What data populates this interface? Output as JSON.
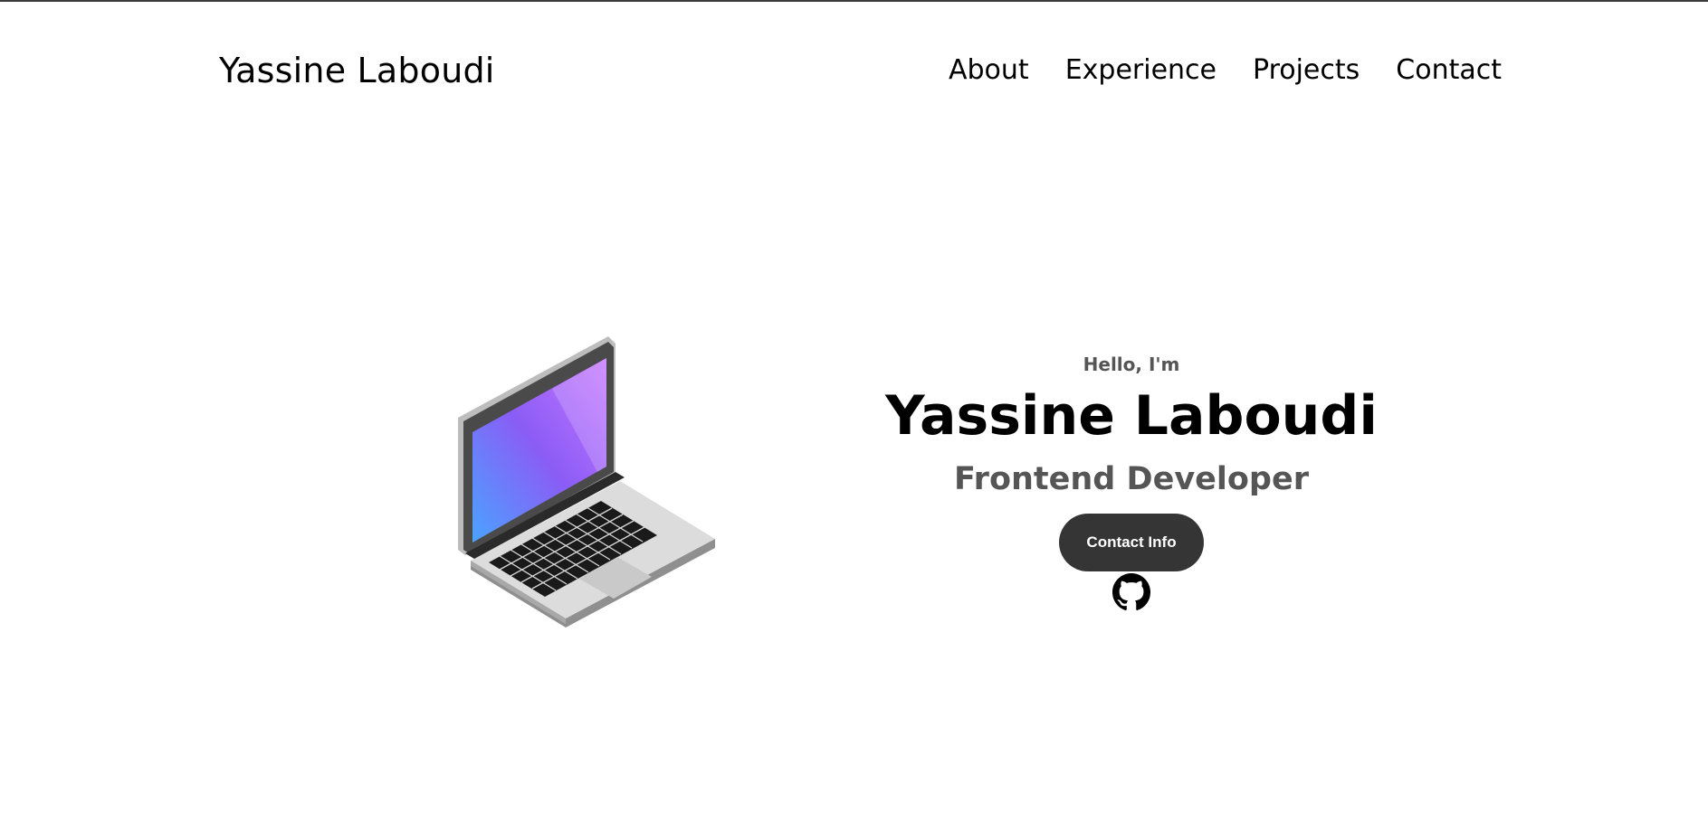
{
  "header": {
    "logo": "Yassine Laboudi",
    "nav": [
      {
        "label": "About"
      },
      {
        "label": "Experience"
      },
      {
        "label": "Projects"
      },
      {
        "label": "Contact"
      }
    ]
  },
  "hero": {
    "greeting": "Hello, I'm",
    "name": "Yassine Laboudi",
    "role": "Frontend Developer",
    "contact_button": "Contact Info",
    "icons": {
      "illustration": "laptop-illustration",
      "social": "github-icon"
    }
  },
  "colors": {
    "button_bg": "#353535",
    "subtitle": "#555555",
    "screen_gradient": [
      "#c879ff",
      "#8b5cf6",
      "#4aa3ff"
    ]
  }
}
